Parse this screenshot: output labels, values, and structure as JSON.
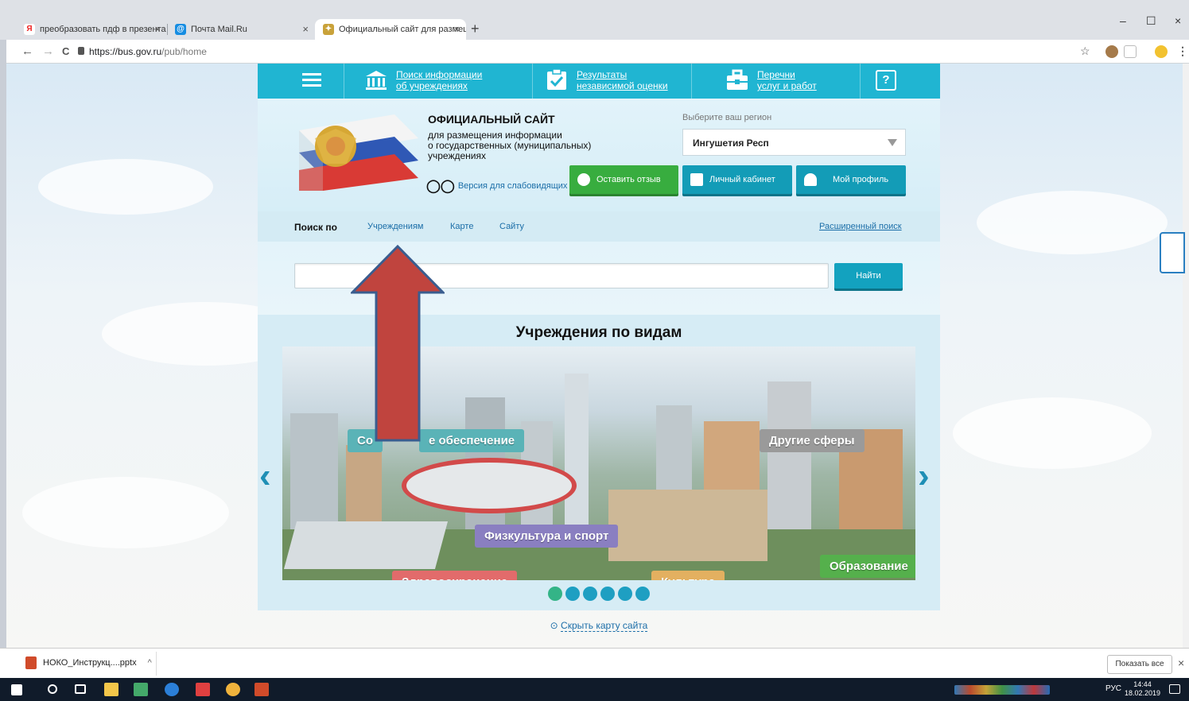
{
  "browser": {
    "tabs": [
      {
        "title": "преобразовать пдф в презента",
        "close": "×"
      },
      {
        "title": "Почта Mail.Ru",
        "close": "×"
      },
      {
        "title": "Официальный сайт для размещ",
        "close": "×"
      }
    ],
    "new_tab": "+",
    "window_controls": {
      "minimize": "–",
      "maximize": "☐",
      "close": "×"
    },
    "url_host": "https://bus.gov.ru",
    "url_path": "/pub/home",
    "nav": {
      "back": "←",
      "forward": "→",
      "reload": "C"
    },
    "star": "☆",
    "menu": "⋮"
  },
  "site": {
    "topnav": [
      {
        "line1": "Поиск информации",
        "line2": "об учреждениях",
        "icon": "institution-icon"
      },
      {
        "line1": "Результаты",
        "line2": "независимой оценки",
        "icon": "checklist-icon"
      },
      {
        "line1": "Перечни",
        "line2": "услуг и работ",
        "icon": "briefcase-icon"
      }
    ],
    "help": "?",
    "title": "ОФИЦИАЛЬНЫЙ САЙТ",
    "subtitle_lines": [
      "для размещения информации",
      "о государственных (муниципальных)",
      "учреждениях"
    ],
    "low_vision": "Версия для слабовидящих",
    "region_label": "Выберите ваш регион",
    "region_value": "Ингушетия Респ",
    "buttons": {
      "feedback": "Оставить отзыв",
      "cabinet": "Личный кабинет",
      "profile": "Мой профиль"
    },
    "search_by": {
      "label": "Поиск по",
      "options": [
        "Учреждениям",
        "Карте",
        "Сайту"
      ],
      "advanced": "Расширенный поиск"
    },
    "search": {
      "placeholder": "",
      "button": "Найти"
    },
    "carousel": {
      "title": "Учреждения по видам",
      "tags": [
        {
          "label": "Социальное обеспечение",
          "visible_part_a": "Со",
          "visible_part_b": "е обеспечение",
          "color": "#5ab3b7"
        },
        {
          "label": "Другие сферы",
          "color": "#9a9a9a"
        },
        {
          "label": "Физкультура и спорт",
          "color": "#8a7fc1"
        },
        {
          "label": "Здравоохранение",
          "color": "#e26b6b"
        },
        {
          "label": "Культура",
          "color": "#e3b060"
        },
        {
          "label": "Образование",
          "color": "#55b04c"
        }
      ],
      "dots": 6,
      "active_dot": 1
    },
    "hide_map": "Скрыть карту сайта"
  },
  "downloads": {
    "file": "НОКО_Инструкц....pptx",
    "chevron": "^",
    "show_all": "Показать все",
    "close": "×"
  },
  "taskbar": {
    "lang": "РУС",
    "time": "14:44",
    "date": "18.02.2019"
  },
  "colors": {
    "accent": "#20b5d2",
    "green": "#38ad3f",
    "teal": "#139cb7",
    "link": "#1b6ea8",
    "red_arrow": "#c0443e"
  }
}
